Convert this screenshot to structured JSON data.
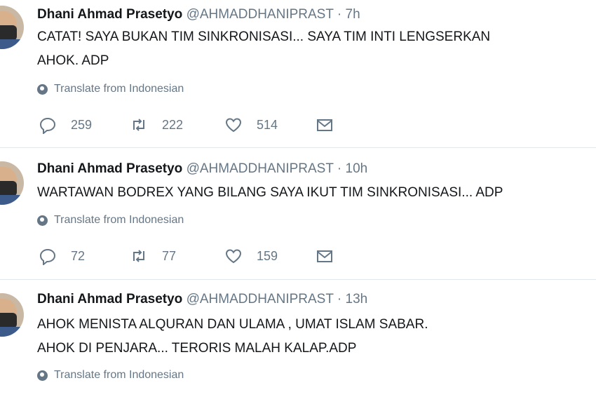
{
  "tweets": [
    {
      "name": "Dhani Ahmad Prasetyo",
      "handle": "@AHMADDHANIPRAST",
      "dot": "·",
      "time": "7h",
      "lines": [
        "CATAT! SAYA BUKAN TIM SINKRONISASI... SAYA TIM INTI LENGSERKAN",
        "AHOK. ADP"
      ],
      "translate": "Translate from Indonesian",
      "replies": "259",
      "retweets": "222",
      "likes": "514"
    },
    {
      "name": "Dhani Ahmad Prasetyo",
      "handle": "@AHMADDHANIPRAST",
      "dot": "·",
      "time": "10h",
      "lines": [
        "WARTAWAN BODREX YANG BILANG SAYA IKUT TIM SINKRONISASI... ADP"
      ],
      "translate": "Translate from Indonesian",
      "replies": "72",
      "retweets": "77",
      "likes": "159"
    },
    {
      "name": "Dhani Ahmad Prasetyo",
      "handle": "@AHMADDHANIPRAST",
      "dot": "·",
      "time": "13h",
      "lines": [
        "AHOK MENISTA ALQURAN DAN ULAMA , UMAT ISLAM SABAR.",
        "AHOK DI PENJARA... TERORIS MALAH KALAP.ADP"
      ],
      "translate": "Translate from Indonesian"
    }
  ],
  "icons": {
    "reply": "reply-icon",
    "retweet": "retweet-icon",
    "like": "heart-icon",
    "message": "envelope-icon",
    "translate": "globe-icon"
  },
  "colors": {
    "text": "#14171a",
    "secondary": "#657786",
    "divider": "#e1e8ed"
  }
}
